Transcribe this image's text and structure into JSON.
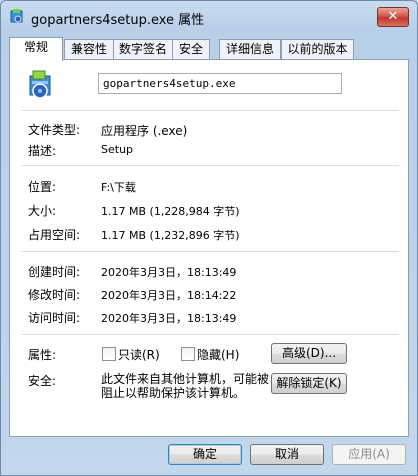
{
  "window": {
    "title": "gopartners4setup.exe 属性",
    "close_label": "✕"
  },
  "tabs": [
    {
      "label": "常规",
      "active": true
    },
    {
      "label": "兼容性"
    },
    {
      "label": "数字签名"
    },
    {
      "label": "安全"
    },
    {
      "label": "详细信息"
    },
    {
      "label": "以前的版本"
    }
  ],
  "general": {
    "file_name": "gopartners4setup.exe",
    "file_type_label": "文件类型:",
    "file_type_value": "应用程序 (.exe)",
    "description_label": "描述:",
    "description_value": "Setup",
    "location_label": "位置:",
    "location_value": "F:\\下载",
    "size_label": "大小:",
    "size_value": "1.17 MB (1,228,984 字节)",
    "size_on_disk_label": "占用空间:",
    "size_on_disk_value": "1.17 MB (1,232,896 字节)",
    "created_label": "创建时间:",
    "created_value": "2020年3月3日，18:13:49",
    "modified_label": "修改时间:",
    "modified_value": "2020年3月3日，18:14:22",
    "accessed_label": "访问时间:",
    "accessed_value": "2020年3月3日，18:13:49",
    "attributes_label": "属性:",
    "readonly_label": "只读(R)",
    "hidden_label": "隐藏(H)",
    "advanced_button": "高级(D)...",
    "security_label": "安全:",
    "security_text": "此文件来自其他计算机，可能被阻止以帮助保护该计算机。",
    "unblock_button": "解除锁定(K)"
  },
  "footer": {
    "ok_button": "确定",
    "cancel_button": "取消",
    "apply_button": "应用(A)"
  },
  "colors": {
    "accent": "#3c7fb1",
    "frame": "#b8cfe8"
  }
}
